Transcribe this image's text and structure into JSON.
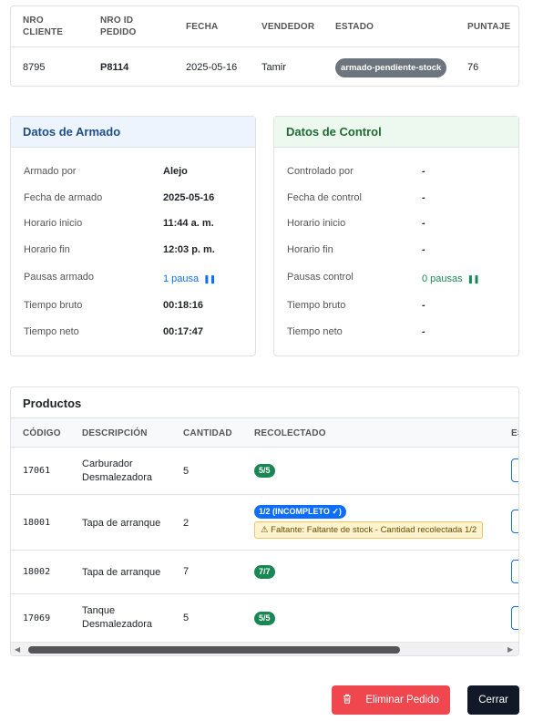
{
  "order": {
    "headers": [
      "NRO CLIENTE",
      "NRO ID PEDIDO",
      "FECHA",
      "VENDEDOR",
      "ESTADO",
      "PUNTAJE"
    ],
    "cliente": "8795",
    "pedido": "P8114",
    "fecha": "2025-05-16",
    "vendedor": "Tamir",
    "estado": "armado-pendiente-stock",
    "puntaje": "76"
  },
  "armado": {
    "title": "Datos de Armado",
    "rows": [
      {
        "label": "Armado por",
        "value": "Alejo"
      },
      {
        "label": "Fecha de armado",
        "value": "2025-05-16"
      },
      {
        "label": "Horario inicio",
        "value": "11:44 a. m."
      },
      {
        "label": "Horario fin",
        "value": "12:03 p. m."
      },
      {
        "label": "Pausas armado",
        "value": "1 pausa"
      },
      {
        "label": "Tiempo bruto",
        "value": "00:18:16"
      },
      {
        "label": "Tiempo neto",
        "value": "00:17:47"
      }
    ]
  },
  "control": {
    "title": "Datos de Control",
    "rows": [
      {
        "label": "Controlado por",
        "value": "-"
      },
      {
        "label": "Fecha de control",
        "value": "-"
      },
      {
        "label": "Horario inicio",
        "value": "-"
      },
      {
        "label": "Horario fin",
        "value": "-"
      },
      {
        "label": "Pausas control",
        "value": "0 pausas"
      },
      {
        "label": "Tiempo bruto",
        "value": "-"
      },
      {
        "label": "Tiempo neto",
        "value": "-"
      }
    ]
  },
  "products": {
    "title": "Productos",
    "headers": [
      "CÓDIGO",
      "DESCRIPCIÓN",
      "CANTIDAD",
      "RECOLECTADO",
      "ES"
    ],
    "rows": [
      {
        "code": "17061",
        "desc": "Carburador Desmalezadora",
        "qty": "5",
        "rec": "5/5"
      },
      {
        "code": "18001",
        "desc": "Tapa de arranque",
        "qty": "2",
        "rec": "1/2 (INCOMPLETO ✓)",
        "warning": "Faltante: Faltante de stock - Cantidad recolectada 1/2"
      },
      {
        "code": "18002",
        "desc": "Tapa de arranque",
        "qty": "7",
        "rec": "7/7"
      },
      {
        "code": "17069",
        "desc": "Tanque Desmalezadora",
        "qty": "5",
        "rec": "5/5"
      }
    ]
  },
  "footer": {
    "delete_label": "Eliminar Pedido",
    "close_label": "Cerrar"
  },
  "colors": {
    "danger": "#f0474f",
    "success": "#198754",
    "primary": "#0d6efd",
    "dark": "#111827"
  },
  "icons": [
    "pause-icon",
    "trash-icon",
    "warning-icon",
    "scroll-left-icon",
    "scroll-right-icon"
  ]
}
